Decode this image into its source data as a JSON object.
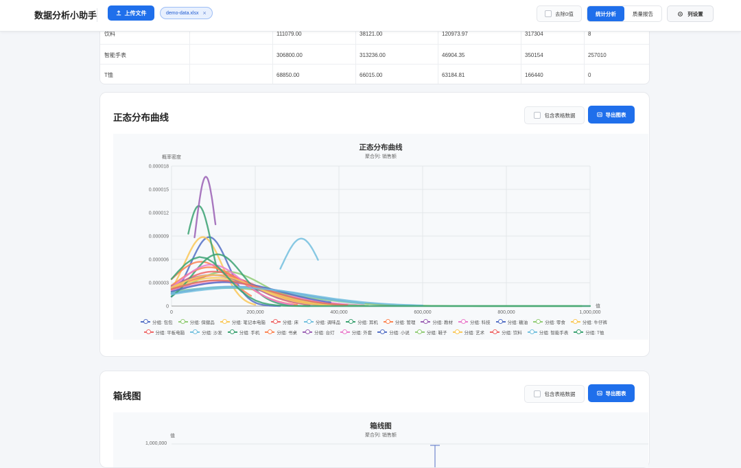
{
  "header": {
    "app_title": "数据分析小助手",
    "upload_label": "上传文件",
    "file_name": "demo-data.xlsx",
    "remove_zero_label": "去除0值",
    "tab_stats": "统计分析",
    "tab_quality": "质量报告",
    "column_settings_label": "列设置"
  },
  "table": {
    "rows": [
      {
        "name": "饮料",
        "c2": "",
        "c3": "111079.00",
        "c4": "38121.00",
        "c5": "120973.97",
        "c6": "317304",
        "c7": "8"
      },
      {
        "name": "智能手表",
        "c2": "",
        "c3": "306800.00",
        "c4": "313236.00",
        "c5": "46904.35",
        "c6": "350154",
        "c7": "257010"
      },
      {
        "name": "T恤",
        "c2": "",
        "c3": "68850.00",
        "c4": "66015.00",
        "c5": "63184.81",
        "c6": "166440",
        "c7": "0"
      }
    ]
  },
  "normal_card": {
    "title": "正态分布曲线",
    "include_table_label": "包含表格数据",
    "export_label": "导出图表"
  },
  "box_card": {
    "title": "箱线图",
    "include_table_label": "包含表格数据",
    "export_label": "导出图表"
  },
  "chart_data": [
    {
      "type": "line",
      "title": "正态分布曲线",
      "subtitle": "聚合列: 销售额",
      "xlabel": "值",
      "ylabel": "概率密度",
      "xlim": [
        0,
        1000000
      ],
      "ylim": [
        0,
        1.8e-05
      ],
      "x_ticks": [
        "0",
        "200,000",
        "400,000",
        "600,000",
        "800,000",
        "1,000,000"
      ],
      "y_ticks": [
        "0",
        "0.000003",
        "0.000006",
        "0.000009",
        "0.000012",
        "0.000015",
        "0.000018"
      ],
      "grid": true,
      "legend_position": "bottom",
      "series": [
        {
          "name": "分组: 包包",
          "color": "#5470c6",
          "mean": 90000,
          "sd": 45000,
          "range": [
            0,
            260000
          ]
        },
        {
          "name": "分组: 保健品",
          "color": "#91cc75",
          "mean": 130000,
          "sd": 90000,
          "range": [
            0,
            380000
          ]
        },
        {
          "name": "分组: 笔记本电脑",
          "color": "#fac858",
          "mean": 75000,
          "sd": 45000,
          "range": [
            0,
            200000
          ]
        },
        {
          "name": "分组: 床",
          "color": "#ee6666",
          "mean": 110000,
          "sd": 100000,
          "range": [
            0,
            410000
          ]
        },
        {
          "name": "分组: 调味品",
          "color": "#73c0de",
          "mean": 310000,
          "sd": 46000,
          "range": [
            260000,
            350000
          ]
        },
        {
          "name": "分组: 耳机",
          "color": "#3ba272",
          "mean": 65000,
          "sd": 31000,
          "range": [
            40000,
            110000
          ]
        },
        {
          "name": "分组: 管理",
          "color": "#fc8452",
          "mean": 70000,
          "sd": 70000,
          "range": [
            0,
            190000
          ]
        },
        {
          "name": "分组: 教材",
          "color": "#9a60b4",
          "mean": 82000,
          "sd": 24000,
          "range": [
            55000,
            105000
          ]
        },
        {
          "name": "分组: 科技",
          "color": "#ea7ccc",
          "mean": 120000,
          "sd": 130000,
          "range": [
            0,
            460000
          ]
        },
        {
          "name": "分组: 糖油",
          "color": "#5470c6",
          "mean": 150000,
          "sd": 160000,
          "range": [
            0,
            580000
          ]
        },
        {
          "name": "分组: 零食",
          "color": "#91cc75",
          "mean": 120000,
          "sd": 170000,
          "range": [
            0,
            980000
          ]
        },
        {
          "name": "分组: 牛仔裤",
          "color": "#fac858",
          "mean": 105000,
          "sd": 110000,
          "range": [
            0,
            420000
          ]
        },
        {
          "name": "分组: 平板电脑",
          "color": "#ee6666",
          "mean": 100000,
          "sd": 90000,
          "range": [
            0,
            330000
          ]
        },
        {
          "name": "分组: 沙发",
          "color": "#73c0de",
          "mean": 140000,
          "sd": 160000,
          "range": [
            0,
            460000
          ]
        },
        {
          "name": "分组: 手机",
          "color": "#3ba272",
          "mean": 110000,
          "sd": 60000,
          "range": [
            0,
            330000
          ]
        },
        {
          "name": "分组: 书桌",
          "color": "#fc8452",
          "mean": 90000,
          "sd": 80000,
          "range": [
            0,
            300000
          ]
        },
        {
          "name": "分组: 台灯",
          "color": "#9a60b4",
          "mean": 95000,
          "sd": 100000,
          "range": [
            0,
            350000
          ]
        },
        {
          "name": "分组: 外套",
          "color": "#ea7ccc",
          "mean": 95000,
          "sd": 75000,
          "range": [
            0,
            290000
          ]
        },
        {
          "name": "分组: 小说",
          "color": "#5470c6",
          "mean": 130000,
          "sd": 130000,
          "range": [
            0,
            380000
          ]
        },
        {
          "name": "分组: 鞋子",
          "color": "#91cc75",
          "mean": 110000,
          "sd": 120000,
          "range": [
            0,
            470000
          ]
        },
        {
          "name": "分组: 艺术",
          "color": "#fac858",
          "mean": 100000,
          "sd": 100000,
          "range": [
            0,
            380000
          ]
        },
        {
          "name": "分组: 饮料",
          "color": "#ee6666",
          "mean": 111079,
          "sd": 120974,
          "range": [
            0,
            420000
          ]
        },
        {
          "name": "分组: 智能手表",
          "color": "#73c0de",
          "mean": 160000,
          "sd": 170000,
          "range": [
            0,
            600000
          ]
        },
        {
          "name": "分组: T恤",
          "color": "#3ba272",
          "mean": 68850,
          "sd": 63185,
          "range": [
            0,
            1000000
          ]
        }
      ]
    },
    {
      "type": "box",
      "title": "箱线图",
      "subtitle": "聚合列: 销售额",
      "ylabel": "值",
      "y_ticks": [
        "1,000,000"
      ]
    }
  ]
}
